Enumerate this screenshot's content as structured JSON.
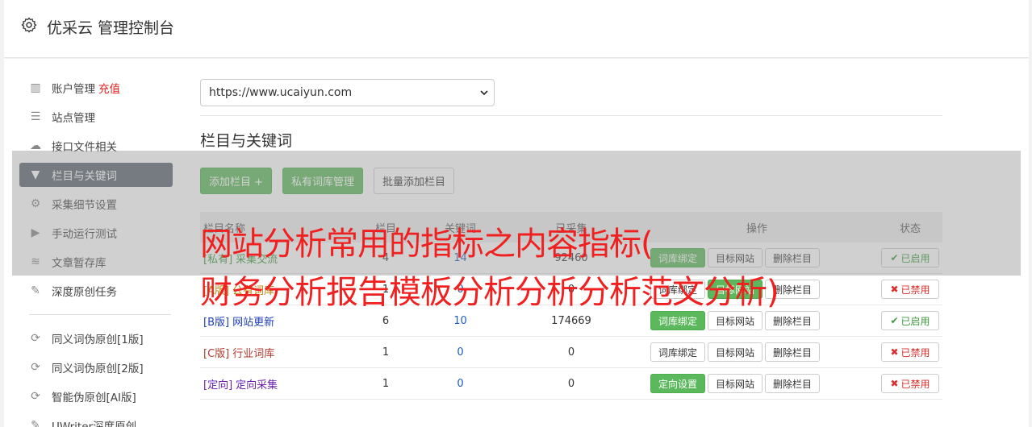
{
  "header": {
    "title": "优采云 管理控制台"
  },
  "sidebar": {
    "group1": [
      {
        "label": "账户管理",
        "extra": "充值",
        "icon": "bar-chart-icon"
      },
      {
        "label": "站点管理",
        "icon": "server-icon"
      },
      {
        "label": "接口文件相关",
        "icon": "cloud-upload-icon"
      },
      {
        "label": "栏目与关键词",
        "icon": "filter-icon",
        "active": true
      },
      {
        "label": "采集细节设置",
        "icon": "cogs-icon"
      },
      {
        "label": "手动运行测试",
        "icon": "play-icon"
      },
      {
        "label": "文章暂存库",
        "icon": "database-icon"
      },
      {
        "label": "深度原创任务",
        "icon": "edit-icon"
      }
    ],
    "group2": [
      {
        "label": "同义词伪原创[1版]",
        "icon": "refresh-icon"
      },
      {
        "label": "同义词伪原创[2版]",
        "icon": "refresh-icon"
      },
      {
        "label": "智能伪原创[AI版]",
        "icon": "refresh-icon"
      },
      {
        "label": "UWriter深度原创",
        "icon": "edit-icon"
      }
    ]
  },
  "site_select": {
    "value": "https://www.ucaiyun.com"
  },
  "section": {
    "title": "栏目与关键词"
  },
  "toolbar": {
    "add_column": "添加栏目 +",
    "private_lib": "私有词库管理",
    "batch_add": "批量添加栏目"
  },
  "table": {
    "headers": {
      "name": "栏目名称",
      "c2": "栏目",
      "c3": "关键词",
      "c4": "已采集",
      "ops": "操作",
      "status": "状态"
    },
    "rows": [
      {
        "tag": "[私有]",
        "name": "采集交流",
        "a": "4",
        "b": "14",
        "c": "92460",
        "op1": "词库绑定",
        "op1_green": true,
        "op2": "目标网站",
        "op2_green": false,
        "op3": "删除栏目",
        "status": "已启用",
        "on": true,
        "color": "#3c9a3c"
      },
      {
        "tag": "[A版]",
        "name": "公有词库",
        "a": "1",
        "b": "0",
        "c": "0",
        "op1": "词库绑定",
        "op1_green": false,
        "op2": "目标网站",
        "op2_green": true,
        "op3": "删除栏目",
        "status": "已禁用",
        "on": false,
        "color": "#b8860b"
      },
      {
        "tag": "[B版]",
        "name": "网站更新",
        "a": "6",
        "b": "10",
        "c": "174669",
        "op1": "词库绑定",
        "op1_green": true,
        "op2": "目标网站",
        "op2_green": false,
        "op3": "删除栏目",
        "status": "已启用",
        "on": true,
        "color": "#1e3fb8"
      },
      {
        "tag": "[C版]",
        "name": "行业词库",
        "a": "1",
        "b": "0",
        "c": "0",
        "op1": "词库绑定",
        "op1_green": false,
        "op2": "目标网站",
        "op2_green": false,
        "op3": "删除栏目",
        "status": "已禁用",
        "on": false,
        "color": "#b03a2e"
      },
      {
        "tag": "[定向]",
        "name": "定向采集",
        "a": "1",
        "b": "0",
        "c": "0",
        "op1": "定向设置",
        "op1_green": true,
        "op2": "目标网站",
        "op2_green": false,
        "op3": "删除栏目",
        "status": "已禁用",
        "on": false,
        "color": "#6a1fb0"
      }
    ]
  },
  "overlay": {
    "line1": "网站分析常用的指标之内容指标(",
    "line2": "财务分析报告模板分析分析分析范文分析)"
  }
}
